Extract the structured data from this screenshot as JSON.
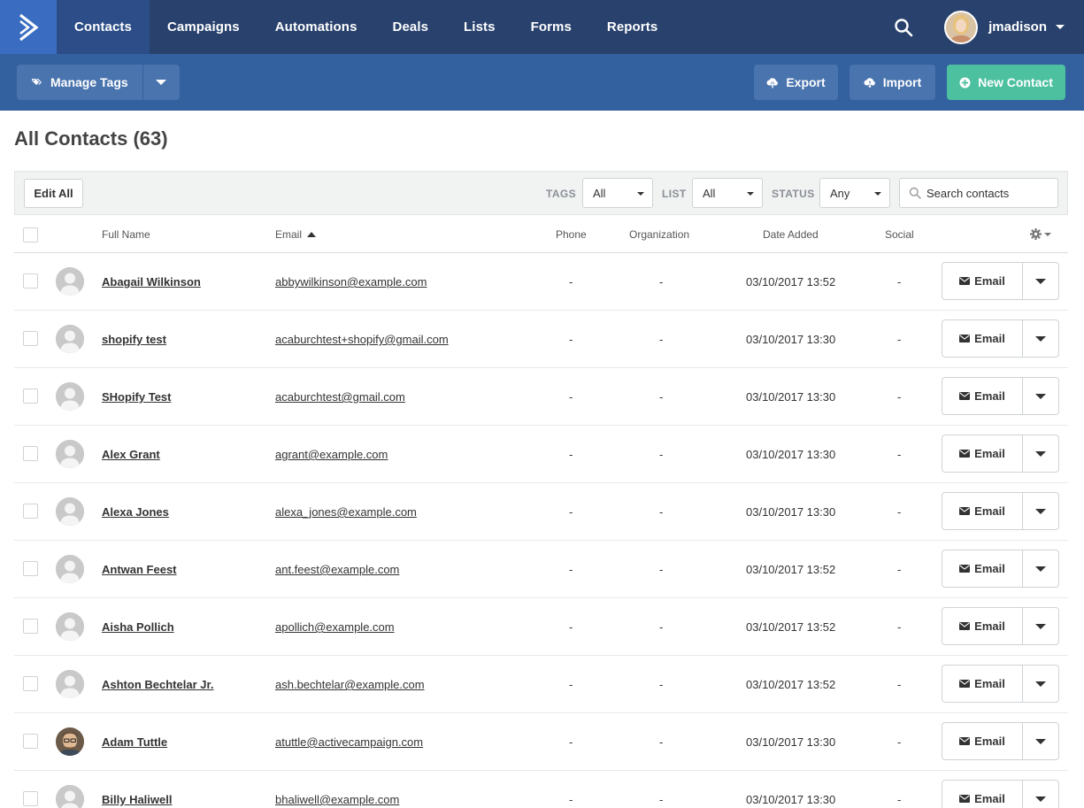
{
  "nav": {
    "items": [
      {
        "label": "Contacts",
        "active": true
      },
      {
        "label": "Campaigns",
        "active": false
      },
      {
        "label": "Automations",
        "active": false
      },
      {
        "label": "Deals",
        "active": false
      },
      {
        "label": "Lists",
        "active": false
      },
      {
        "label": "Forms",
        "active": false
      },
      {
        "label": "Reports",
        "active": false
      }
    ],
    "username": "jmadison"
  },
  "actionbar": {
    "manage_tags": "Manage Tags",
    "export": "Export",
    "import": "Import",
    "new_contact": "New Contact"
  },
  "page": {
    "title": "All Contacts (63)"
  },
  "filters": {
    "edit_all": "Edit All",
    "tags_label": "TAGS",
    "tags_value": "All",
    "list_label": "LIST",
    "list_value": "All",
    "status_label": "STATUS",
    "status_value": "Any",
    "search_placeholder": "Search contacts"
  },
  "table": {
    "columns": {
      "full_name": "Full Name",
      "email": "Email",
      "phone": "Phone",
      "organization": "Organization",
      "date_added": "Date Added",
      "social": "Social"
    },
    "email_button": "Email",
    "rows": [
      {
        "name": "Abagail Wilkinson",
        "email": "abbywilkinson@example.com",
        "phone": "-",
        "organization": "-",
        "date": "03/10/2017 13:52",
        "social": "-",
        "photo": false
      },
      {
        "name": "shopify test",
        "email": "acaburchtest+shopify@gmail.com",
        "phone": "-",
        "organization": "-",
        "date": "03/10/2017 13:30",
        "social": "-",
        "photo": false
      },
      {
        "name": "SHopify Test",
        "email": "acaburchtest@gmail.com",
        "phone": "-",
        "organization": "-",
        "date": "03/10/2017 13:30",
        "social": "-",
        "photo": false
      },
      {
        "name": "Alex Grant",
        "email": "agrant@example.com",
        "phone": "-",
        "organization": "-",
        "date": "03/10/2017 13:30",
        "social": "-",
        "photo": false
      },
      {
        "name": "Alexa Jones",
        "email": "alexa_jones@example.com",
        "phone": "-",
        "organization": "-",
        "date": "03/10/2017 13:30",
        "social": "-",
        "photo": false
      },
      {
        "name": "Antwan Feest",
        "email": "ant.feest@example.com",
        "phone": "-",
        "organization": "-",
        "date": "03/10/2017 13:52",
        "social": "-",
        "photo": false
      },
      {
        "name": "Aisha Pollich",
        "email": "apollich@example.com",
        "phone": "-",
        "organization": "-",
        "date": "03/10/2017 13:52",
        "social": "-",
        "photo": false
      },
      {
        "name": "Ashton Bechtelar Jr.",
        "email": "ash.bechtelar@example.com",
        "phone": "-",
        "organization": "-",
        "date": "03/10/2017 13:52",
        "social": "-",
        "photo": false
      },
      {
        "name": "Adam Tuttle",
        "email": "atuttle@activecampaign.com",
        "phone": "-",
        "organization": "-",
        "date": "03/10/2017 13:30",
        "social": "-",
        "photo": true
      },
      {
        "name": "Billy Haliwell",
        "email": "bhaliwell@example.com",
        "phone": "-",
        "organization": "-",
        "date": "03/10/2017 13:30",
        "social": "-",
        "photo": false
      }
    ]
  },
  "colors": {
    "nav_bg": "#29426d",
    "nav_active": "#2c4d87",
    "logo_bg": "#3a6dc1",
    "actionbar_bg": "#33609f",
    "actionbar_button": "#4a74ae",
    "new_contact_green": "#4dc0a0"
  },
  "icons": {
    "logo": "activecampaign-chevron-icon",
    "search": "search-icon",
    "tag": "tag-icon",
    "export": "cloud-upload-icon",
    "import": "cloud-download-icon",
    "new_contact": "plus-circle-icon",
    "filter_search": "search-icon",
    "settings": "gear-icon",
    "email": "envelope-icon",
    "sort": "sort-ascending-icon"
  }
}
